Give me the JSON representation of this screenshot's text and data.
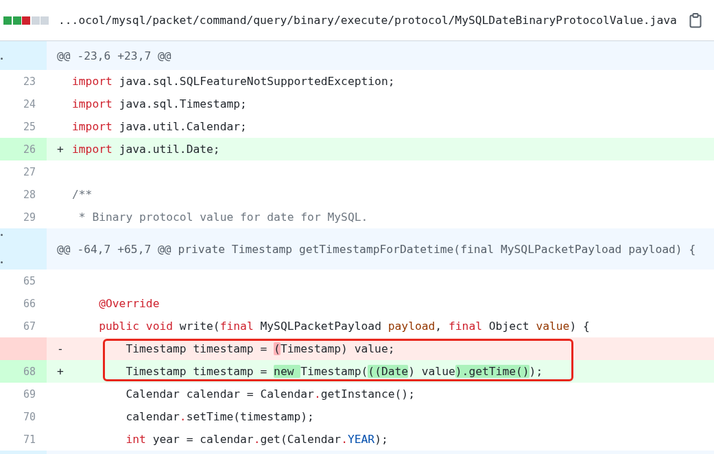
{
  "file_header": {
    "diffstat": [
      {
        "kind": "add"
      },
      {
        "kind": "add"
      },
      {
        "kind": "del"
      },
      {
        "kind": "neutral"
      },
      {
        "kind": "neutral"
      }
    ],
    "path": "...ocol/mysql/packet/command/query/binary/execute/protocol/MySQLDateBinaryProtocolValue.java"
  },
  "lines": [
    {
      "kind": "hunk",
      "expand_up": false,
      "expand_down": true,
      "text": "@@ -23,6 +23,7 @@"
    },
    {
      "kind": "context",
      "number": "23",
      "tokens": [
        {
          "text": "import",
          "kind": "kw"
        },
        {
          "text": " java.sql.SQLFeatureNotSupportedException;",
          "kind": "plain"
        }
      ]
    },
    {
      "kind": "context",
      "number": "24",
      "tokens": [
        {
          "text": "import",
          "kind": "kw"
        },
        {
          "text": " java.sql.Timestamp;",
          "kind": "plain"
        }
      ]
    },
    {
      "kind": "context",
      "number": "25",
      "tokens": [
        {
          "text": "import",
          "kind": "kw"
        },
        {
          "text": " java.util.Calendar;",
          "kind": "plain"
        }
      ]
    },
    {
      "kind": "add",
      "number": "26",
      "marker": "+",
      "tokens": [
        {
          "text": "import",
          "kind": "kw"
        },
        {
          "text": " java.util.Date;",
          "kind": "plain"
        }
      ]
    },
    {
      "kind": "context",
      "number": "27"
    },
    {
      "kind": "context",
      "number": "28",
      "tokens": [
        {
          "text": "/**",
          "kind": "comment"
        }
      ]
    },
    {
      "kind": "context",
      "number": "29",
      "tokens": [
        {
          "text": " * Binary protocol value for date for MySQL.",
          "kind": "comment"
        }
      ]
    },
    {
      "kind": "hunk",
      "expand_up": true,
      "expand_down": true,
      "text": "@@ -64,7 +65,7 @@ private Timestamp getTimestampForDatetime(final MySQLPacketPayload payload) {"
    },
    {
      "kind": "context",
      "number": "65"
    },
    {
      "kind": "context",
      "number": "66",
      "tokens": [
        {
          "text": "    @Override",
          "kind": "kw"
        }
      ]
    },
    {
      "kind": "context",
      "number": "67",
      "tokens": [
        {
          "text": "    public void",
          "kind": "kw"
        },
        {
          "text": " write(",
          "kind": "plain"
        },
        {
          "text": "final",
          "kind": "kw"
        },
        {
          "text": " MySQLPacketPayload ",
          "kind": "plain"
        },
        {
          "text": "payload",
          "kind": "param"
        },
        {
          "text": ", ",
          "kind": "plain"
        },
        {
          "text": "final",
          "kind": "kw"
        },
        {
          "text": " Object ",
          "kind": "plain"
        },
        {
          "text": "value",
          "kind": "param"
        },
        {
          "text": ") {",
          "kind": "plain"
        }
      ]
    },
    {
      "kind": "del",
      "marker": "-",
      "boxed": true,
      "tokens": [
        {
          "text": "        Timestamp timestamp = ",
          "kind": "plain"
        },
        {
          "text": "(",
          "kind": "hl"
        },
        {
          "text": "Timestamp) value;",
          "kind": "plain"
        }
      ]
    },
    {
      "kind": "add",
      "number": "68",
      "marker": "+",
      "boxed": true,
      "tokens": [
        {
          "text": "        Timestamp timestamp = ",
          "kind": "plain"
        },
        {
          "text": "new ",
          "kind": "hl"
        },
        {
          "text": "Timestamp(",
          "kind": "plain"
        },
        {
          "text": "((Date",
          "kind": "hl"
        },
        {
          "text": ") value",
          "kind": "plain"
        },
        {
          "text": ").getTime()",
          "kind": "hl"
        },
        {
          "text": ");",
          "kind": "plain"
        }
      ]
    },
    {
      "kind": "context",
      "number": "69",
      "tokens": [
        {
          "text": "        Calendar calendar = Calendar",
          "kind": "plain"
        },
        {
          "text": ".",
          "kind": "op"
        },
        {
          "text": "getInstance();",
          "kind": "plain"
        }
      ]
    },
    {
      "kind": "context",
      "number": "70",
      "tokens": [
        {
          "text": "        calendar",
          "kind": "plain"
        },
        {
          "text": ".",
          "kind": "op"
        },
        {
          "text": "setTime(timestamp);",
          "kind": "plain"
        }
      ]
    },
    {
      "kind": "context",
      "number": "71",
      "tokens": [
        {
          "text": "        int",
          "kind": "kw"
        },
        {
          "text": " year = calendar",
          "kind": "plain"
        },
        {
          "text": ".",
          "kind": "op"
        },
        {
          "text": "get(Calendar",
          "kind": "plain"
        },
        {
          "text": ".",
          "kind": "op"
        },
        {
          "text": "YEAR",
          "kind": "const"
        },
        {
          "text": ");",
          "kind": "plain"
        }
      ]
    }
  ]
}
